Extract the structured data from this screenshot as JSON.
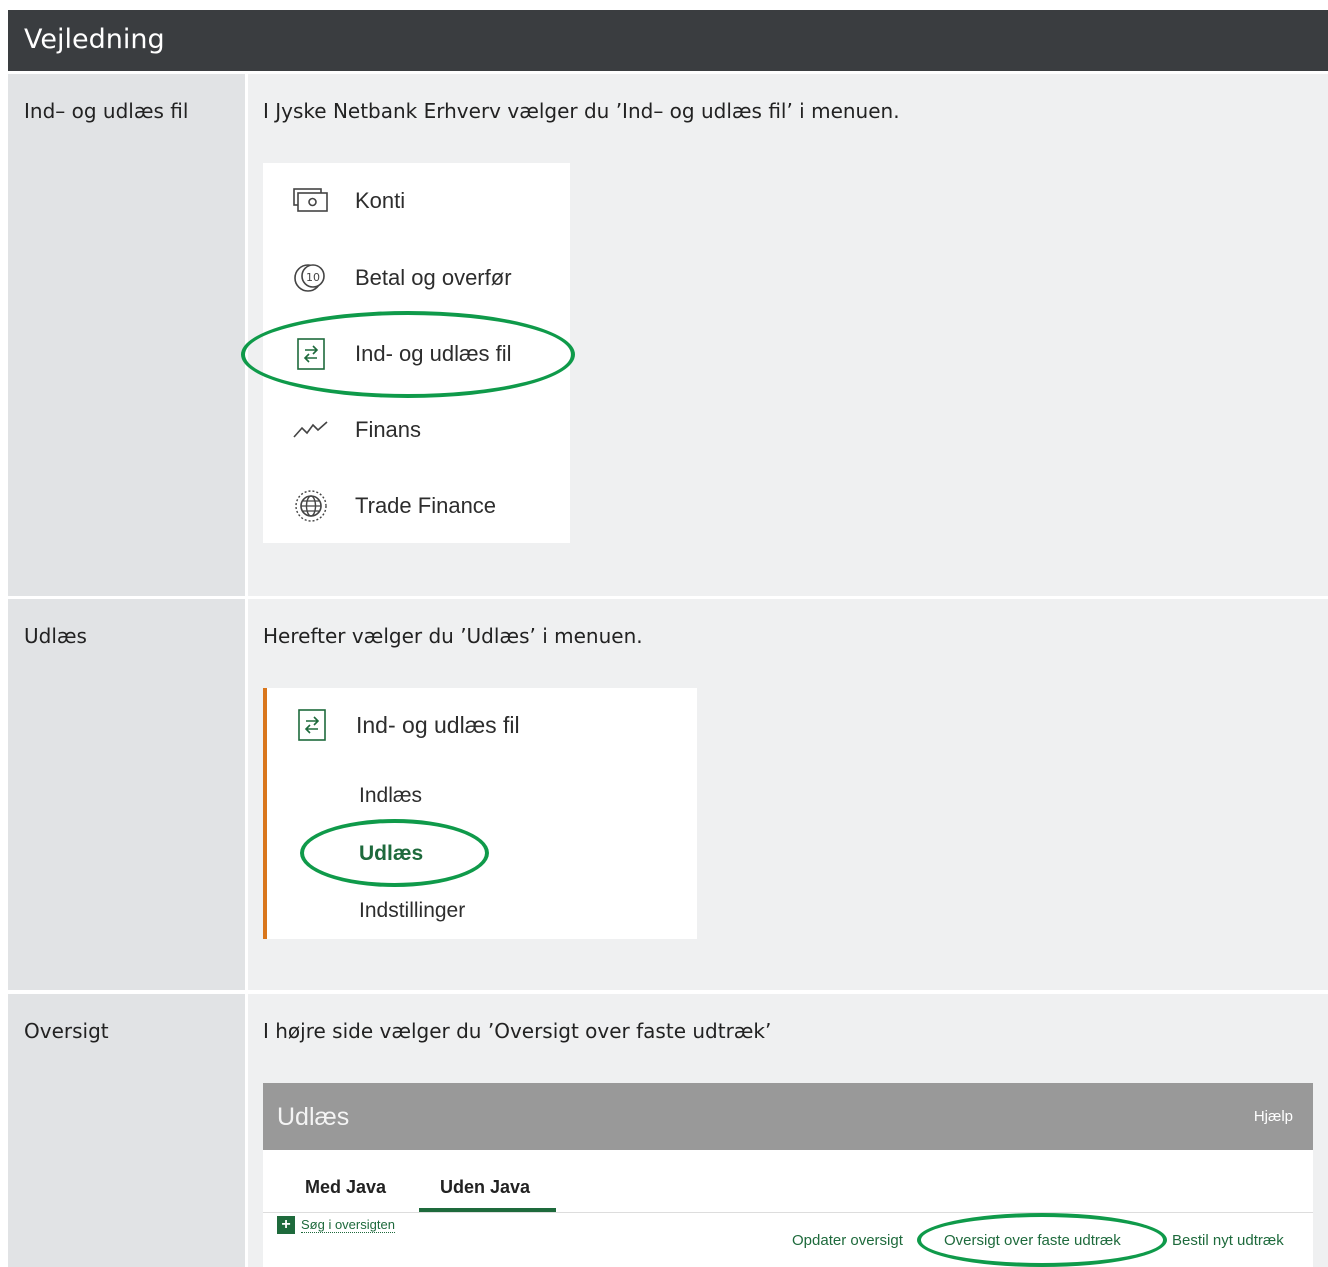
{
  "header": {
    "title": "Vejledning"
  },
  "rows": [
    {
      "label": "Ind– og udlæs fil",
      "text": "I Jyske Netbank Erhverv vælger du ’Ind– og udlæs fil’ i menuen."
    },
    {
      "label": "Udlæs",
      "text": "Herefter vælger du ’Udlæs’ i menuen."
    },
    {
      "label": "Oversigt",
      "text": "I højre side vælger du ’Oversigt over faste udtræk’"
    }
  ],
  "menu1": {
    "items": [
      {
        "label": "Konti",
        "icon": "banknote-icon"
      },
      {
        "label": "Betal og overfør",
        "icon": "coin-icon"
      },
      {
        "label": "Ind- og udlæs fil",
        "icon": "transfer-icon"
      },
      {
        "label": "Finans",
        "icon": "trend-icon"
      },
      {
        "label": "Trade Finance",
        "icon": "globe-icon"
      }
    ]
  },
  "menu2": {
    "heading": "Ind- og udlæs fil",
    "items": [
      "Indlæs",
      "Udlæs",
      "Indstillinger"
    ],
    "accent": "#d9761c"
  },
  "udlaes": {
    "title": "Udlæs",
    "help": "Hjælp",
    "tabs": [
      "Med Java",
      "Uden Java"
    ],
    "search": "Søg i oversigten",
    "actions": [
      "Opdater oversigt",
      "Oversigt over faste udtræk",
      "Bestil nyt udtræk"
    ]
  },
  "colors": {
    "highlight": "#0f9a4a",
    "brand_green": "#1e6a3c"
  }
}
